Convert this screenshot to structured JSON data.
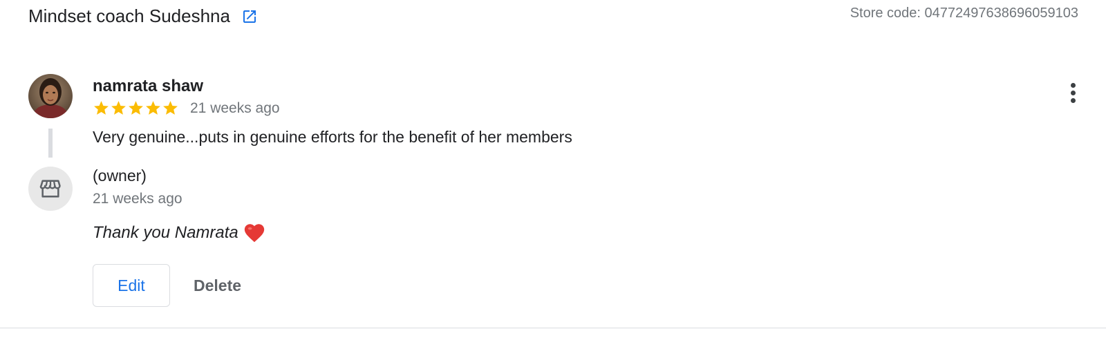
{
  "header": {
    "business_name": "Mindset coach Sudeshna",
    "external_link_icon": "open-in-new-icon",
    "store_code": "Store code: 04772497638696059103"
  },
  "review": {
    "reviewer_name": "namrata shaw",
    "avatar_icon": "reviewer-photo",
    "rating": 5,
    "max_rating": 5,
    "time_ago": "21 weeks ago",
    "text": "Very genuine...puts in genuine efforts for the benefit of her members",
    "more_icon": "more-vert-icon"
  },
  "owner_reply": {
    "label": "(owner)",
    "avatar_icon": "storefront-icon",
    "time_ago": "21 weeks ago",
    "text": "Thank you Namrata",
    "emoji_icon": "red-heart-icon"
  },
  "actions": {
    "edit_label": "Edit",
    "delete_label": "Delete"
  },
  "colors": {
    "star": "#fbbc04",
    "link_blue": "#1a73e8",
    "secondary_text": "#70757a",
    "heart": "#e53935"
  }
}
